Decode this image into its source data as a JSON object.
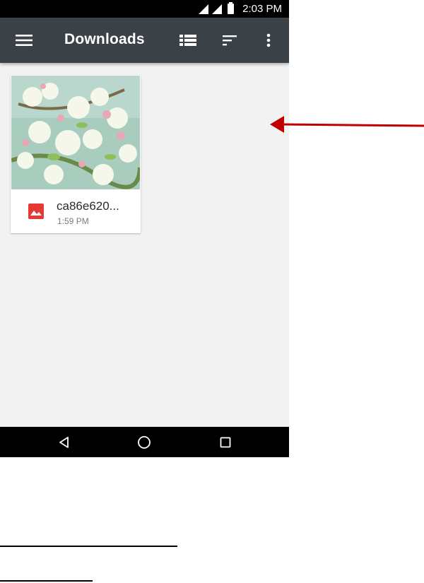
{
  "status_bar": {
    "time": "2:03 PM"
  },
  "app_bar": {
    "title": "Downloads"
  },
  "files": [
    {
      "name": "ca86e620...",
      "time": "1:59 PM",
      "type_icon": "image-icon",
      "icon_color": "#e53935"
    }
  ],
  "colors": {
    "app_bar": "#3a4147",
    "background": "#f2f2f2",
    "annotation_arrow": "#c00000"
  }
}
